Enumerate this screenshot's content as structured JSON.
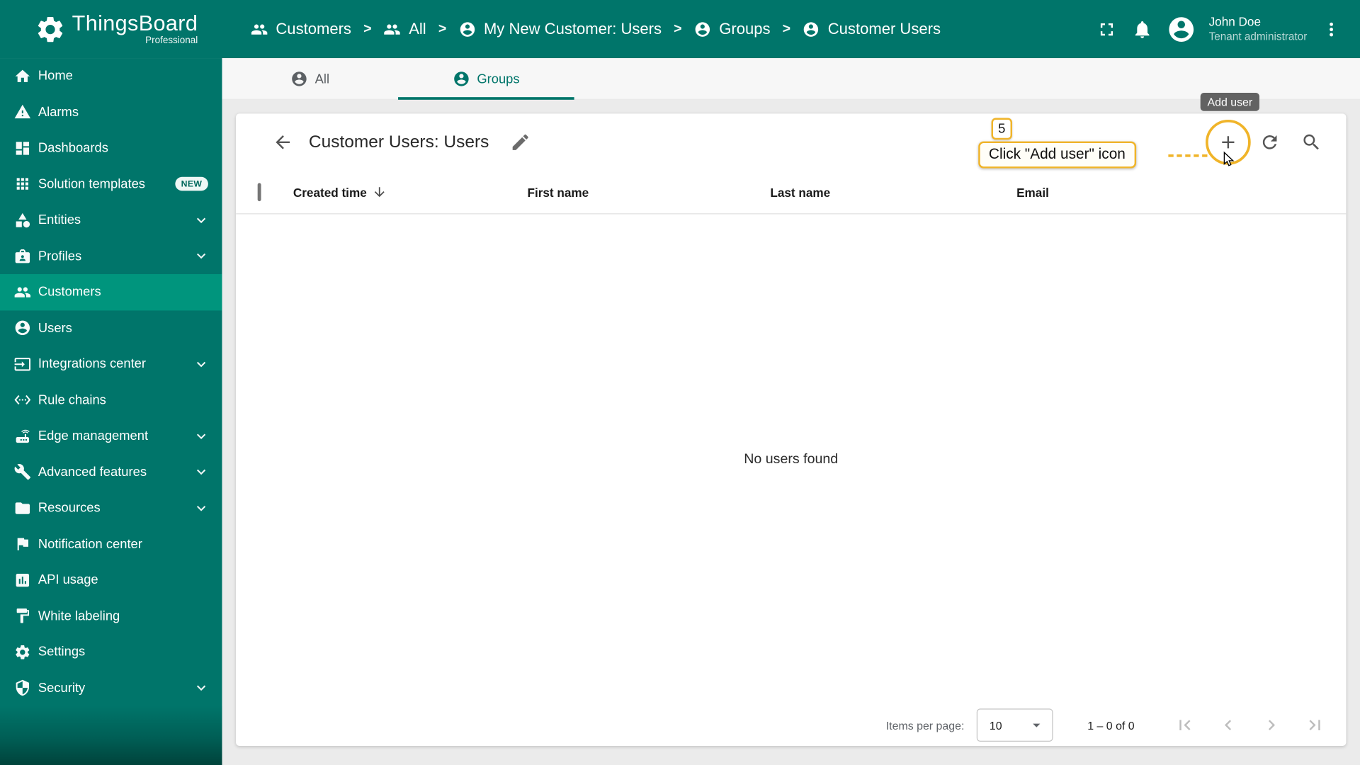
{
  "brand": {
    "name": "ThingsBoard",
    "edition": "Professional",
    "color_primary": "#00756a",
    "color_sidebar_active": "#00957d",
    "color_annotation": "#f0b429"
  },
  "header": {
    "separator": ">",
    "breadcrumb": [
      {
        "label": "Customers"
      },
      {
        "label": "All"
      },
      {
        "label": "My New Customer: Users"
      },
      {
        "label": "Groups"
      },
      {
        "label": "Customer Users"
      }
    ],
    "user_name": "John Doe",
    "user_role": "Tenant administrator"
  },
  "sidebar": {
    "items": [
      {
        "label": "Home"
      },
      {
        "label": "Alarms"
      },
      {
        "label": "Dashboards"
      },
      {
        "label": "Solution templates",
        "badge": "NEW"
      },
      {
        "label": "Entities"
      },
      {
        "label": "Profiles"
      },
      {
        "label": "Customers"
      },
      {
        "label": "Users"
      },
      {
        "label": "Integrations center"
      },
      {
        "label": "Rule chains"
      },
      {
        "label": "Edge management"
      },
      {
        "label": "Advanced features"
      },
      {
        "label": "Resources"
      },
      {
        "label": "Notification center"
      },
      {
        "label": "API usage"
      },
      {
        "label": "White labeling"
      },
      {
        "label": "Settings"
      },
      {
        "label": "Security"
      }
    ]
  },
  "tabs": {
    "all": "All",
    "groups": "Groups"
  },
  "content": {
    "title": "Customer Users: Users",
    "columns": {
      "created_time": "Created time",
      "first_name": "First name",
      "last_name": "Last name",
      "email": "Email"
    },
    "empty_text": "No users found",
    "paginator": {
      "items_per_page_label": "Items per page:",
      "page_size": "10",
      "range": "1 – 0 of 0"
    }
  },
  "annotation": {
    "step": "5",
    "instruction": "Click \"Add user\" icon",
    "tooltip": "Add user"
  }
}
